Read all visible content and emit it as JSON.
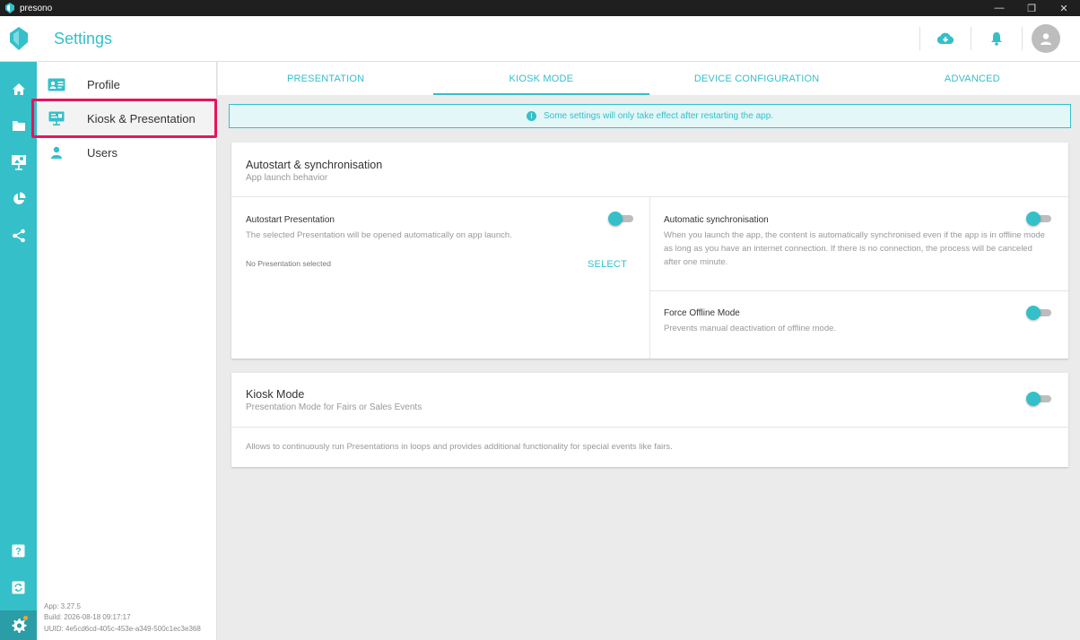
{
  "window": {
    "app_name": "presono",
    "minimize": "—",
    "maximize": "❐",
    "close": "✕"
  },
  "header": {
    "title": "Settings"
  },
  "sidebar": {
    "items": [
      {
        "label": "Profile"
      },
      {
        "label": "Kiosk & Presentation"
      },
      {
        "label": "Users"
      }
    ],
    "app_version": "App: 3.27.5",
    "build": "Build: 2026-08-18 09:17:17",
    "uuid": "UUID: 4e5cd6cd-405c-453e-a349-500c1ec3e368"
  },
  "tabs": [
    {
      "label": "PRESENTATION"
    },
    {
      "label": "KIOSK MODE"
    },
    {
      "label": "DEVICE CONFIGURATION"
    },
    {
      "label": "ADVANCED"
    }
  ],
  "banner": {
    "text": "Some settings will only take effect after restarting the app."
  },
  "autostart_card": {
    "title": "Autostart & synchronisation",
    "subtitle": "App launch behavior",
    "autostart": {
      "title": "Autostart Presentation",
      "desc": "The selected Presentation will be opened automatically on app launch.",
      "empty": "No Presentation selected",
      "select_label": "SELECT",
      "enabled": false
    },
    "sync": {
      "title": "Automatic synchronisation",
      "desc": "When you launch the app, the content is automatically synchronised even if the app is in offline mode as long as you have an internet connection. If there is no connection, the process will be canceled after one minute.",
      "enabled": false
    },
    "offline": {
      "title": "Force Offline Mode",
      "desc": "Prevents manual deactivation of offline mode.",
      "enabled": false
    }
  },
  "kiosk_card": {
    "title": "Kiosk Mode",
    "subtitle": "Presentation Mode for Fairs or Sales Events",
    "desc": "Allows to continuously run Presentations in loops and provides additional functionality for special events like fairs.",
    "enabled": false
  },
  "colors": {
    "accent": "#35bfc9",
    "highlight": "#e8135f",
    "titlebar": "#1f1f1f"
  }
}
